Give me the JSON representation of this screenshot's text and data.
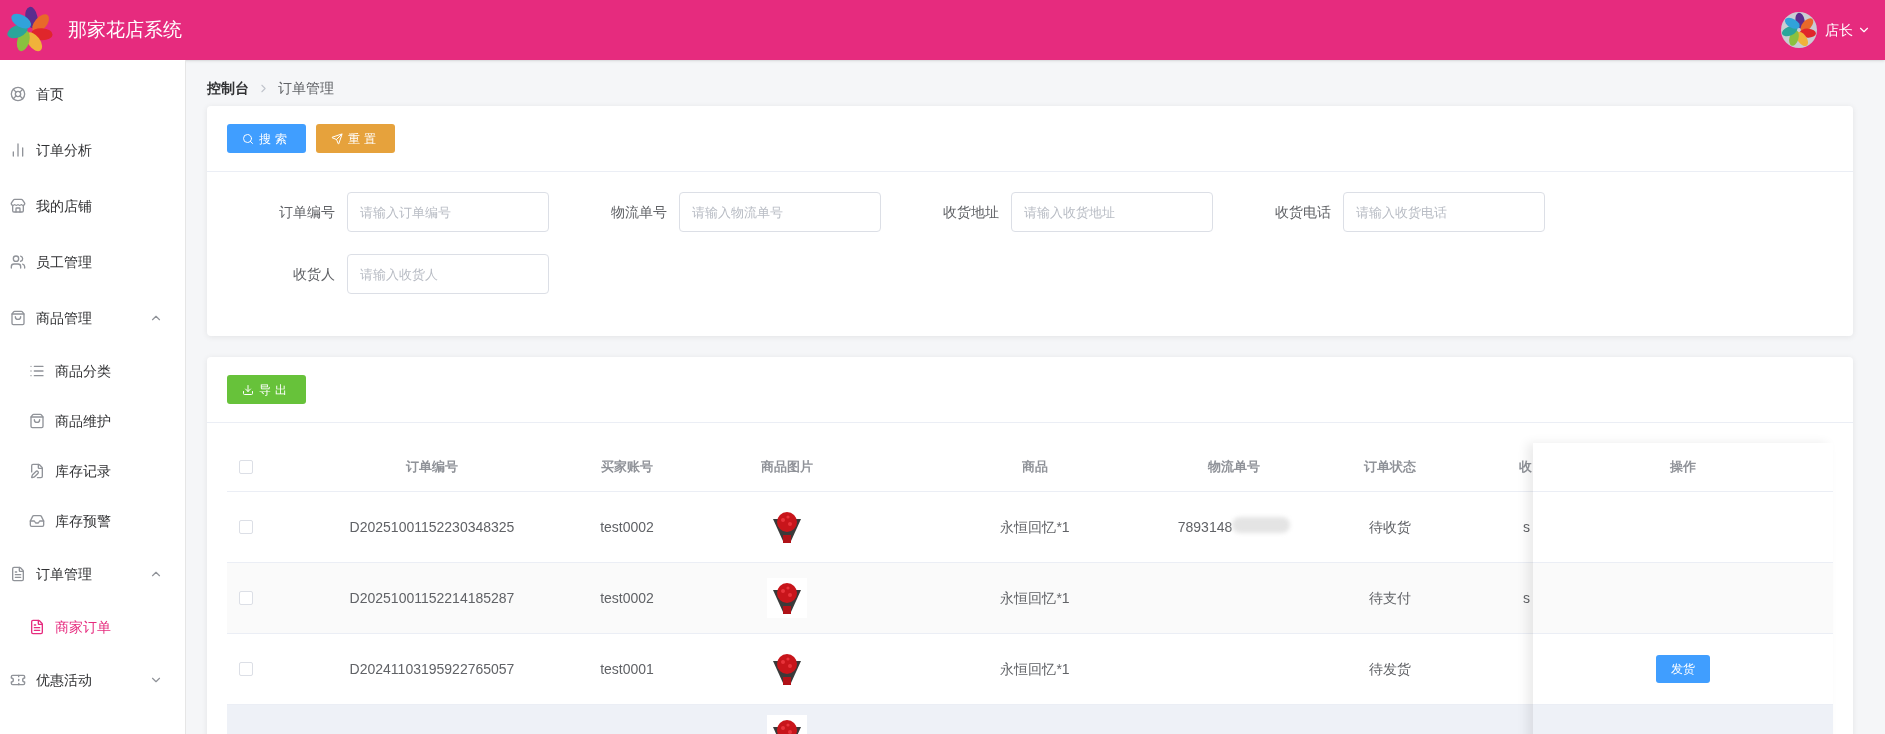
{
  "header": {
    "title": "那家花店系统",
    "user": "店长"
  },
  "sidebar": {
    "items": [
      {
        "label": "首页",
        "selected": false
      },
      {
        "label": "订单分析",
        "selected": false
      },
      {
        "label": "我的店铺",
        "selected": false
      },
      {
        "label": "员工管理",
        "selected": false
      },
      {
        "label": "商品管理",
        "selected": false,
        "expanded": true,
        "children": [
          {
            "label": "商品分类",
            "selected": false
          },
          {
            "label": "商品维护",
            "selected": false
          },
          {
            "label": "库存记录",
            "selected": false
          },
          {
            "label": "库存预警",
            "selected": false
          }
        ]
      },
      {
        "label": "订单管理",
        "selected": false,
        "expanded": true,
        "children": [
          {
            "label": "商家订单",
            "selected": true
          }
        ]
      },
      {
        "label": "优惠活动",
        "selected": false,
        "expanded": false
      }
    ]
  },
  "breadcrumb": [
    {
      "label": "控制台",
      "link": true
    },
    {
      "label": "订单管理",
      "link": false
    }
  ],
  "search_panel": {
    "buttons": [
      {
        "label": "搜索",
        "kind": "search"
      },
      {
        "label": "重置",
        "kind": "reset"
      }
    ],
    "fields": [
      {
        "label": "订单编号",
        "placeholder": "请输入订单编号"
      },
      {
        "label": "物流单号",
        "placeholder": "请输入物流单号"
      },
      {
        "label": "收货地址",
        "placeholder": "请输入收货地址"
      },
      {
        "label": "收货电话",
        "placeholder": "请输入收货电话"
      },
      {
        "label": "收货人",
        "placeholder": "请输入收货人"
      }
    ]
  },
  "table_panel": {
    "export_button": "导出",
    "table": {
      "select_all_checked": false,
      "columns": [
        "订单编号",
        "买家账号",
        "商品图片",
        "商品",
        "物流单号",
        "订单状态",
        "收"
      ],
      "action_column": "操作",
      "rows": [
        {
          "checked": false,
          "hovered": false,
          "order_no": "D2025100115223034832​5",
          "buyer": "test0002",
          "goods": "永恒回忆*1",
          "tracking_no": "7893148",
          "redacted": true,
          "status": "待收货",
          "column_8": "s"
        },
        {
          "checked": false,
          "hovered": false,
          "order_no": "D2025100115221418528​7",
          "buyer": "test0002",
          "goods": "永恒回忆*1",
          "status": "待支付",
          "column_8": "s"
        },
        {
          "checked": false,
          "hovered": false,
          "order_no": "D2024110319592276505​7",
          "buyer": "test0001",
          "goods": "永恒回忆*1",
          "status": "待发货",
          "action": "发货"
        },
        {
          "hovered": true
        }
      ]
    }
  }
}
